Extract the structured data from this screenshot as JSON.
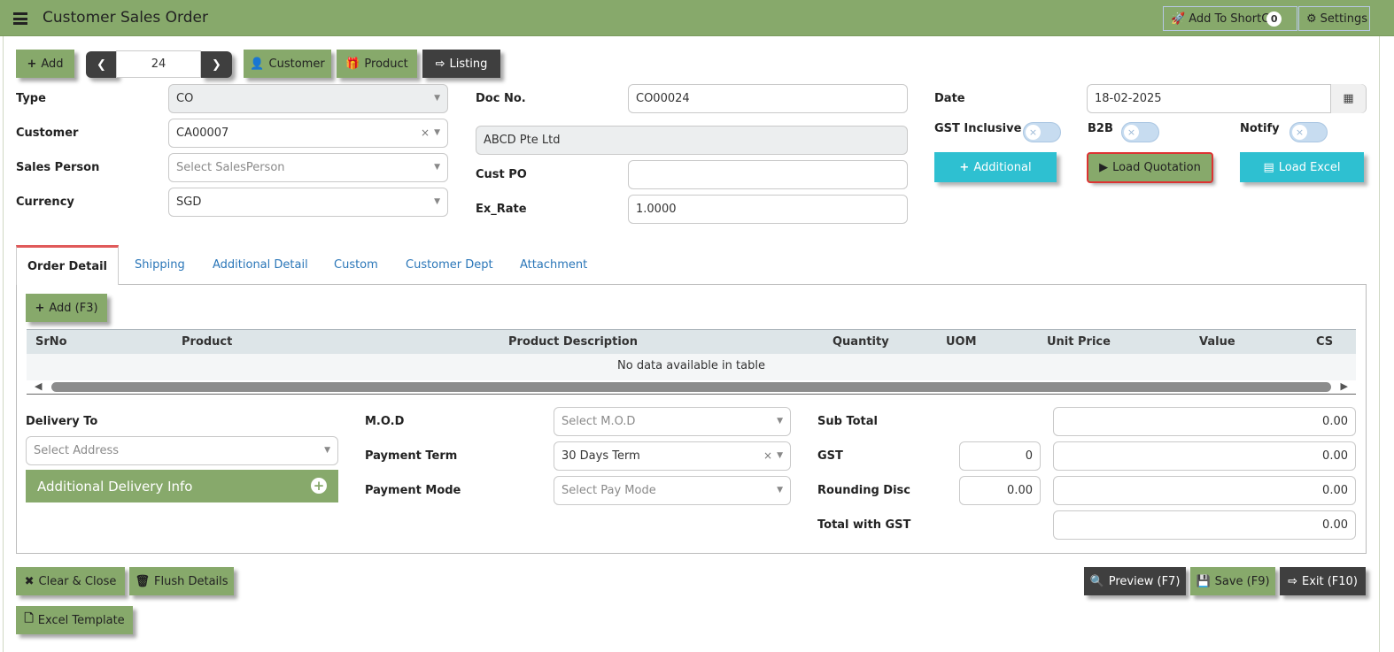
{
  "header": {
    "title": "Customer Sales Order",
    "shortcut_label": "Add To ShortCut",
    "shortcut_count": "0",
    "settings_label": "Settings"
  },
  "toolbar": {
    "add_label": "Add",
    "doc_index": "24",
    "customer_label": "Customer",
    "product_label": "Product",
    "listing_label": "Listing"
  },
  "form": {
    "type_label": "Type",
    "type_value": "CO",
    "customer_label": "Customer",
    "customer_value": "CA00007",
    "salesperson_label": "Sales Person",
    "salesperson_placeholder": "Select SalesPerson",
    "currency_label": "Currency",
    "currency_value": "SGD",
    "docno_label": "Doc No.",
    "docno_value": "CO00024",
    "customer_name": "ABCD Pte Ltd",
    "custpo_label": "Cust PO",
    "custpo_value": "",
    "exrate_label": "Ex_Rate",
    "exrate_value": "1.0000",
    "date_label": "Date",
    "date_value": "18-02-2025",
    "gst_inclusive_label": "GST Inclusive",
    "b2b_label": "B2B",
    "notify_label": "Notify",
    "additional_label": "Additional",
    "load_quotation_label": "Load Quotation",
    "load_excel_label": "Load Excel"
  },
  "tabs": [
    {
      "label": "Order Detail"
    },
    {
      "label": "Shipping"
    },
    {
      "label": "Additional Detail"
    },
    {
      "label": "Custom"
    },
    {
      "label": "Customer Dept"
    },
    {
      "label": "Attachment"
    }
  ],
  "detail": {
    "add_label": "Add (F3)",
    "columns": [
      "SrNo",
      "Product",
      "Product Description",
      "Quantity",
      "UOM",
      "Unit Price",
      "Value",
      "CS"
    ],
    "empty_text": "No data available in table"
  },
  "footer_form": {
    "delivery_to_label": "Delivery To",
    "address_placeholder": "Select Address",
    "additional_delivery_label": "Additional Delivery Info",
    "mod_label": "M.O.D",
    "mod_placeholder": "Select M.O.D",
    "payment_term_label": "Payment Term",
    "payment_term_value": "30 Days Term",
    "payment_mode_label": "Payment Mode",
    "payment_mode_placeholder": "Select Pay Mode",
    "subtotal_label": "Sub Total",
    "subtotal_value": "0.00",
    "gst_label": "GST",
    "gst_rate": "0",
    "gst_value": "0.00",
    "rounding_label": "Rounding Disc",
    "rounding_input": "0.00",
    "rounding_value": "0.00",
    "total_label": "Total with GST",
    "total_value": "0.00"
  },
  "actions": {
    "clear_close": "Clear & Close",
    "flush_details": "Flush Details",
    "excel_template": "Excel Template",
    "preview": "Preview (F7)",
    "save": "Save (F9)",
    "exit": "Exit (F10)"
  },
  "colors": {
    "accent": "#87a96b",
    "dark": "#3f3f3f",
    "teal": "#2ec0d1",
    "link": "#2a76b8"
  }
}
